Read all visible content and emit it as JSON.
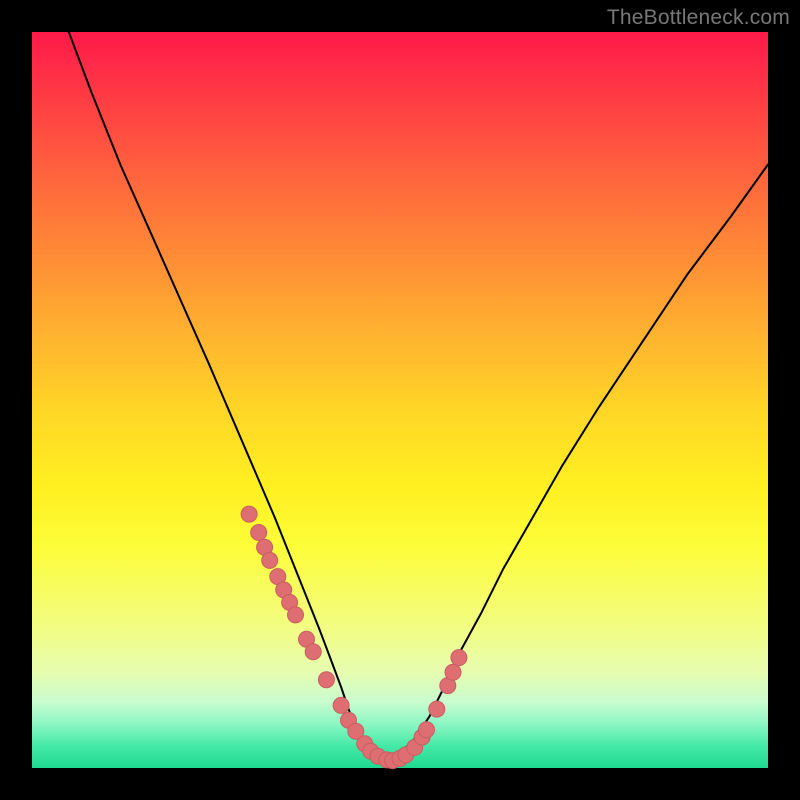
{
  "watermark": "TheBottleneck.com",
  "colors": {
    "curve": "#000000",
    "dot": "#de6e71",
    "dot_stroke": "#c75e62"
  },
  "chart_data": {
    "type": "line",
    "title": "",
    "xlabel": "",
    "ylabel": "",
    "xlim": [
      0,
      100
    ],
    "ylim": [
      0,
      100
    ],
    "series": [
      {
        "name": "bottleneck-curve",
        "x": [
          5,
          8,
          12,
          16,
          20,
          24,
          27,
          30,
          33,
          35,
          37,
          39,
          40.5,
          42,
          43,
          44,
          45,
          46,
          47,
          48,
          49,
          50,
          52,
          54,
          56,
          58,
          61,
          64,
          68,
          72,
          77,
          83,
          89,
          95,
          100
        ],
        "values": [
          100,
          92,
          82,
          73,
          64,
          55,
          48,
          41,
          34,
          29,
          24,
          19,
          15,
          11,
          8,
          5.5,
          3.5,
          2,
          1.2,
          1,
          1.3,
          2,
          4,
          7,
          11,
          15.5,
          21,
          27,
          34,
          41,
          49,
          58,
          67,
          75,
          82
        ]
      }
    ],
    "dots": {
      "name": "highlighted-points",
      "x": [
        29.5,
        30.8,
        31.6,
        32.3,
        33.4,
        34.2,
        35.0,
        35.8,
        37.3,
        38.2,
        40.0,
        42.0,
        43.0,
        44.0,
        45.2,
        46.0,
        47.0,
        48.2,
        49.0,
        50.0,
        50.8,
        52.0,
        53.0,
        53.6,
        55.0,
        56.5,
        57.2,
        58.0
      ],
      "values": [
        34.5,
        32.0,
        30.0,
        28.2,
        26.0,
        24.2,
        22.5,
        20.8,
        17.5,
        15.8,
        12.0,
        8.5,
        6.5,
        5.0,
        3.3,
        2.3,
        1.6,
        1.1,
        1.0,
        1.3,
        1.8,
        2.8,
        4.2,
        5.2,
        8.0,
        11.2,
        13.0,
        15.0
      ]
    }
  }
}
